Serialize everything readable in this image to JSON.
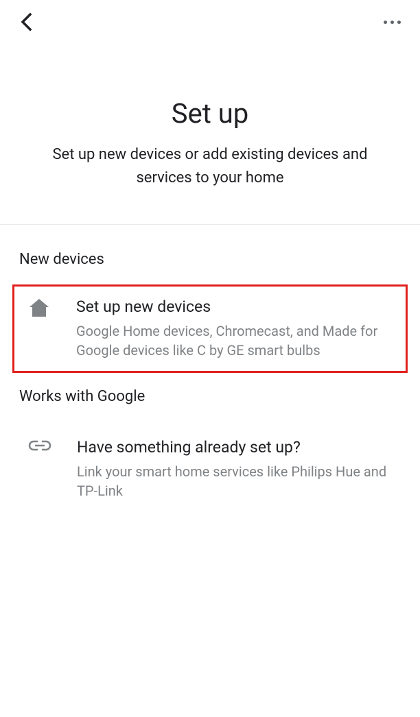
{
  "page": {
    "title": "Set up",
    "subtitle": "Set up new devices or add existing devices and services to your home"
  },
  "sections": {
    "new_devices": {
      "header": "New devices",
      "option1": {
        "title": "Set up new devices",
        "desc": "Google Home devices, Chromecast, and Made for Google devices like C by GE smart bulbs"
      }
    },
    "works_with": {
      "header": "Works with Google",
      "option1": {
        "title": "Have something already set up?",
        "desc": "Link your smart home services like Philips Hue and TP-Link"
      }
    }
  }
}
